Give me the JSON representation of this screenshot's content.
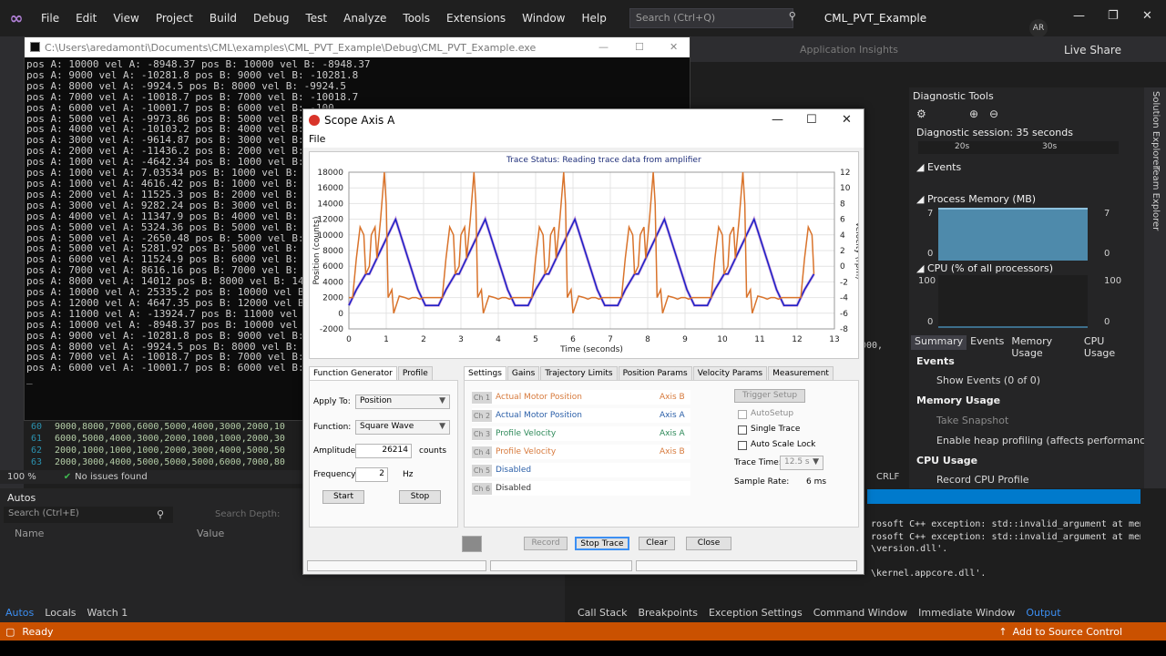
{
  "vs": {
    "menu": [
      "File",
      "Edit",
      "View",
      "Project",
      "Build",
      "Debug",
      "Test",
      "Analyze",
      "Tools",
      "Extensions",
      "Window",
      "Help"
    ],
    "search_placeholder": "Search (Ctrl+Q)",
    "solution_name": "CML_PVT_Example",
    "avatar": "AR",
    "app_insights": "Application Insights",
    "live_share": "Live Share"
  },
  "console": {
    "title": "C:\\Users\\aredamonti\\Documents\\CML\\examples\\CML_PVT_Example\\Debug\\CML_PVT_Example.exe",
    "lines": [
      "pos A: 10000 vel A: -8948.37 pos B: 10000 vel B: -8948.37",
      "pos A: 9000 vel A: -10281.8 pos B: 9000 vel B: -10281.8",
      "pos A: 8000 vel A: -9924.5 pos B: 8000 vel B: -9924.5",
      "pos A: 7000 vel A: -10018.7 pos B: 7000 vel B: -10018.7",
      "pos A: 6000 vel A: -10001.7 pos B: 6000 vel B: -100",
      "pos A: 5000 vel A: -9973.86 pos B: 5000 vel B: -997",
      "pos A: 4000 vel A: -10103.2 pos B: 4000 vel B: -101",
      "pos A: 3000 vel A: -9614.87 pos B: 3000 vel B: -961",
      "pos A: 2000 vel A: -11436.2 pos B: 2000 vel B: -114",
      "pos A: 1000 vel A: -4642.34 pos B: 1000 vel B: -464",
      "pos A: 1000 vel A: 7.03534 pos B: 1000 vel B: 7.035",
      "pos A: 1000 vel A: 4616.42 pos B: 1000 vel B: 4616.",
      "pos A: 2000 vel A: 11525.3 pos B: 2000 vel B: 11525",
      "pos A: 3000 vel A: 9282.24 pos B: 3000 vel B: 9282.",
      "pos A: 4000 vel A: 11347.9 pos B: 4000 vel B: 11347",
      "pos A: 5000 vel A: 5324.36 pos B: 5000 vel B: 5324.",
      "pos A: 5000 vel A: -2650.48 pos B: 5000 vel B: -265",
      "pos A: 5000 vel A: 5281.92 pos B: 5000 vel B: 5281.",
      "pos A: 6000 vel A: 11524.9 pos B: 6000 vel B: 11524",
      "pos A: 7000 vel A: 8616.16 pos B: 7000 vel B: 8616.",
      "pos A: 8000 vel A: 14012 pos B: 8000 vel B: 14012",
      "pos A: 10000 vel A: 25335.2 pos B: 10000 vel B: 253",
      "pos A: 12000 vel A: 4647.35 pos B: 12000 vel B: 464",
      "pos A: 11000 vel A: -13924.7 pos B: 11000 vel B: -1",
      "pos A: 10000 vel A: -8948.37 pos B: 10000 vel B: -8",
      "pos A: 9000 vel A: -10281.8 pos B: 9000 vel B: -102",
      "pos A: 8000 vel A: -9924.5 pos B: 8000 vel B: -9924",
      "pos A: 7000 vel A: -10018.7 pos B: 7000 vel B: -100",
      "pos A: 6000 vel A: -10001.7 pos B: 6000 vel B: -100"
    ],
    "cursor": "_"
  },
  "code": {
    "lines": [
      {
        "n": "60",
        "t": "9000,8000,7000,6000,5000,4000,3000,2000,10"
      },
      {
        "n": "61",
        "t": "6000,5000,4000,3000,2000,1000,1000,2000,30"
      },
      {
        "n": "62",
        "t": "2000,1000,1000,1000,2000,3000,4000,5000,50"
      },
      {
        "n": "63",
        "t": "2000,3000,4000,5000,5000,5000,6000,7000,80"
      }
    ],
    "zoom": "100 %",
    "issues": "No issues found",
    "line_ending": "CRLF"
  },
  "autos": {
    "title": "Autos",
    "search_placeholder": "Search (Ctrl+E)",
    "search_depth": "Search Depth:",
    "col_name": "Name",
    "col_value": "Value",
    "tabs": [
      "Autos",
      "Locals",
      "Watch 1"
    ]
  },
  "output": {
    "lines": [
      "rosoft C++ exception: std::invalid_argument at memory",
      "rosoft C++ exception: std::invalid_argument at memory",
      "\\version.dll'.",
      "",
      "\\kernel.appcore.dll'."
    ],
    "right_tabs": [
      "Call Stack",
      "Breakpoints",
      "Exception Settings",
      "Command Window",
      "Immediate Window",
      "Output"
    ],
    "side_text": "000,"
  },
  "diag": {
    "title": "Diagnostic Tools",
    "session": "Diagnostic session: 35 seconds",
    "t1": "20s",
    "t2": "30s",
    "events_h": "Events",
    "mem_h": "Process Memory (MB)",
    "mem_max": "7",
    "mem_min": "0",
    "cpu_h": "CPU (% of all processors)",
    "cpu_max": "100",
    "cpu_min": "0",
    "tabs": [
      "Summary",
      "Events",
      "Memory Usage",
      "CPU Usage"
    ],
    "events_sec": "Events",
    "show_events": "Show Events (0 of 0)",
    "mem_sec": "Memory Usage",
    "take_snapshot": "Take Snapshot",
    "heap_profiling": "Enable heap profiling (affects performance)",
    "cpu_sec": "CPU Usage",
    "record_cpu": "Record CPU Profile",
    "side_tabs": [
      "Solution Explorer",
      "Team Explorer"
    ]
  },
  "status": {
    "ready": "Ready",
    "add_source": "Add to Source Control"
  },
  "scope": {
    "title": "Scope Axis A",
    "menu_file": "File",
    "trace_status_label": "Trace Status:",
    "trace_status_value": "Reading trace data from amplifier",
    "y_left_label": "Position (counts)",
    "y_right_label": "Velocity (rpm)",
    "x_label": "Time (seconds)",
    "fg_tabs": [
      "Function Generator",
      "Profile"
    ],
    "apply_to_label": "Apply To:",
    "apply_to_value": "Position",
    "function_label": "Function:",
    "function_value": "Square Wave",
    "amplitude_label": "Amplitude:",
    "amplitude_value": "26214",
    "amplitude_unit": "counts",
    "frequency_label": "Frequency:",
    "frequency_value": "2",
    "frequency_unit": "Hz",
    "start": "Start",
    "stop": "Stop",
    "settings_tabs": [
      "Settings",
      "Gains",
      "Trajectory Limits",
      "Position Params",
      "Velocity Params",
      "Measurement"
    ],
    "channels": [
      {
        "ch": "Ch 1",
        "label": "Actual Motor Position",
        "axis": "Axis B",
        "color": "#d77a3c"
      },
      {
        "ch": "Ch 2",
        "label": "Actual Motor Position",
        "axis": "Axis A",
        "color": "#2b5fa8"
      },
      {
        "ch": "Ch 3",
        "label": "Profile Velocity",
        "axis": "Axis A",
        "color": "#2f8a5a"
      },
      {
        "ch": "Ch 4",
        "label": "Profile Velocity",
        "axis": "Axis B",
        "color": "#d77a3c"
      },
      {
        "ch": "Ch 5",
        "label": "Disabled",
        "axis": "",
        "color": "#2b5fa8"
      },
      {
        "ch": "Ch 6",
        "label": "Disabled",
        "axis": "",
        "color": "#333333"
      }
    ],
    "trigger_setup": "Trigger Setup",
    "autosetup": "AutoSetup",
    "single_trace": "Single Trace",
    "auto_scale": "Auto Scale Lock",
    "trace_time_label": "Trace Time:",
    "trace_time_value": "12.5 s",
    "sample_rate_label": "Sample Rate:",
    "sample_rate_value": "6 ms",
    "record": "Record",
    "stop_trace": "Stop Trace",
    "clear": "Clear",
    "close": "Close"
  },
  "chart_data": {
    "type": "line",
    "title": "",
    "xlabel": "Time (seconds)",
    "ylabel": "Position (counts)",
    "y2label": "Velocity (rpm)",
    "xlim": [
      0,
      13
    ],
    "ylim": [
      -2000,
      18000
    ],
    "y2lim": [
      -8,
      12
    ],
    "x_ticks": [
      0,
      1,
      2,
      3,
      4,
      5,
      6,
      7,
      8,
      9,
      10,
      11,
      12,
      13
    ],
    "y_ticks": [
      -2000,
      0,
      2000,
      4000,
      6000,
      8000,
      10000,
      12000,
      14000,
      16000,
      18000
    ],
    "y2_ticks": [
      -8,
      -6,
      -4,
      -2,
      0,
      2,
      4,
      6,
      8,
      10,
      12
    ],
    "grid": true,
    "period_s": 2.4,
    "series": [
      {
        "name": "",
        "axis": "left",
        "color": "#1a1fc7",
        "cycle_x": [
          0,
          0.2,
          0.45,
          0.55,
          0.85,
          1.25,
          1.85,
          2.05,
          2.35
        ],
        "cycle_y": [
          1000,
          3000,
          5000,
          5000,
          8000,
          12000,
          3000,
          1000,
          1000
        ]
      },
      {
        "name": "",
        "axis": "right",
        "color": "#d9732b",
        "cycle_x": [
          0,
          0.1,
          0.2,
          0.3,
          0.4,
          0.45,
          0.55,
          0.6,
          0.7,
          0.75,
          0.85,
          0.95,
          1.0,
          1.05,
          1.15,
          1.2,
          1.35,
          1.5,
          1.6,
          1.7,
          1.8,
          1.9,
          2.0,
          2.1,
          2.2,
          2.3,
          2.4
        ],
        "cycle_y": [
          -4,
          -4,
          1,
          5,
          4,
          -1,
          0,
          4,
          5,
          1,
          6,
          12,
          8,
          -4,
          -3,
          -6,
          -3.8,
          -4,
          -4.2,
          -4,
          -4,
          -4.2,
          -4,
          -4,
          -4,
          -4,
          -4
        ]
      }
    ]
  }
}
